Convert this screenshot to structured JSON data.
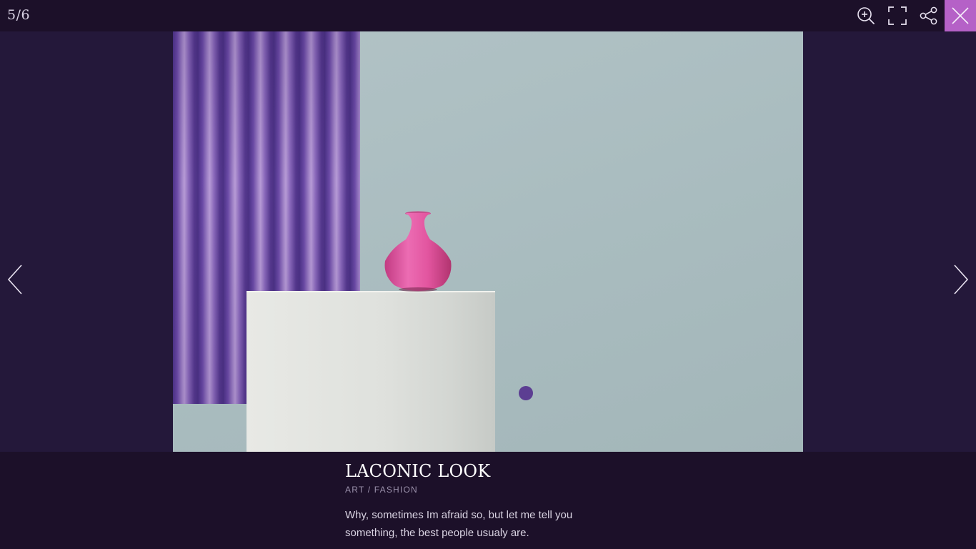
{
  "lightbox": {
    "counter": "5/6",
    "toolbar": {
      "zoom_icon": "zoom-in-icon",
      "fullscreen_icon": "fullscreen-icon",
      "share_icon": "share-icon",
      "close_icon": "close-icon"
    },
    "navigation": {
      "prev_icon": "chevron-left-icon",
      "next_icon": "chevron-right-icon"
    },
    "caption": {
      "title": "LACONIC LOOK",
      "category": "ART / FASHION",
      "description": "Why, sometimes Im afraid so, but let me tell you something, the best people usualy are."
    }
  },
  "colors": {
    "background": "#24183a",
    "bars": "#1c1029",
    "close_accent": "#b561c7",
    "hotspot": "#5c3e92",
    "vase_pink": "#e2559f",
    "wall": "#acc0c3",
    "curtain": "#6b4aa6"
  }
}
